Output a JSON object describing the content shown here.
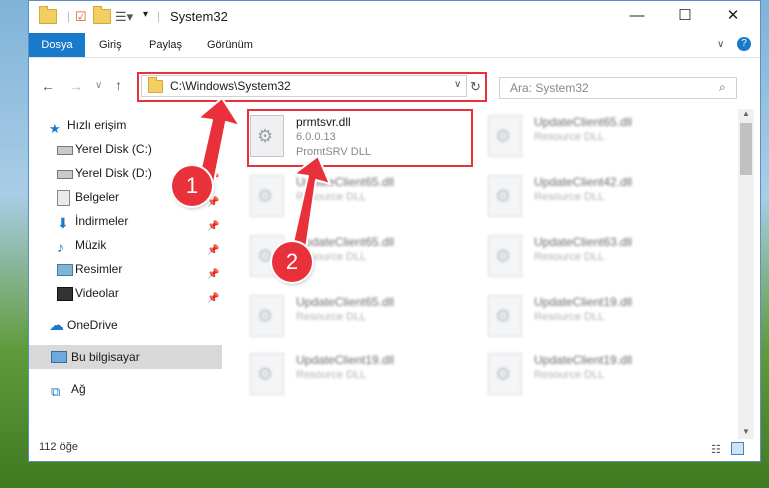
{
  "window": {
    "title": "System32",
    "controls": {
      "minimize": "—",
      "maximize": "☐",
      "close": "✕"
    }
  },
  "ribbon": {
    "tabs": [
      "Dosya",
      "Giriş",
      "Paylaş",
      "Görünüm"
    ],
    "help": "?"
  },
  "address": {
    "path": "C:\\Windows\\System32",
    "search_placeholder": "Ara: System32"
  },
  "sidebar": {
    "items": [
      {
        "label": "Hızlı erişim",
        "icon": "star-icon",
        "pinned": false
      },
      {
        "label": "Yerel Disk (C:)",
        "icon": "drive-icon",
        "pinned": true
      },
      {
        "label": "Yerel Disk (D:)",
        "icon": "drive-icon",
        "pinned": true
      },
      {
        "label": "Belgeler",
        "icon": "documents-icon",
        "pinned": true
      },
      {
        "label": "İndirmeler",
        "icon": "download-icon",
        "pinned": true
      },
      {
        "label": "Müzik",
        "icon": "music-icon",
        "pinned": true
      },
      {
        "label": "Resimler",
        "icon": "pictures-icon",
        "pinned": true
      },
      {
        "label": "Videolar",
        "icon": "video-icon",
        "pinned": true
      },
      {
        "label": "OneDrive",
        "icon": "cloud-icon",
        "pinned": false
      },
      {
        "label": "Bu bilgisayar",
        "icon": "computer-icon",
        "pinned": false,
        "selected": true
      },
      {
        "label": "Ağ",
        "icon": "network-icon",
        "pinned": false
      }
    ]
  },
  "files": {
    "highlighted": {
      "name": "prmtsvr.dll",
      "version": "6.0.0.13",
      "description": "PromtSRV DLL"
    },
    "blurred": [
      {
        "name": "UpdateClient65.dll",
        "description": "Resource DLL"
      },
      {
        "name": "UpdateClient65.dll",
        "description": "Resource DLL"
      },
      {
        "name": "UpdateClient42.dll",
        "description": "Resource DLL"
      },
      {
        "name": "UpdateClient65.dll",
        "description": "Resource DLL"
      },
      {
        "name": "UpdateClient63.dll",
        "description": "Resource DLL"
      },
      {
        "name": "UpdateClient65.dll",
        "description": "Resource DLL"
      },
      {
        "name": "UpdateClient19.dll",
        "description": "Resource DLL"
      },
      {
        "name": "UpdateClient19.dll",
        "description": "Resource DLL"
      },
      {
        "name": "UpdateClient19.dll",
        "description": "Resource DLL"
      }
    ]
  },
  "status": {
    "count": "112 öğe"
  },
  "annotations": {
    "step1": "1",
    "step2": "2",
    "color": "#e8313a"
  }
}
